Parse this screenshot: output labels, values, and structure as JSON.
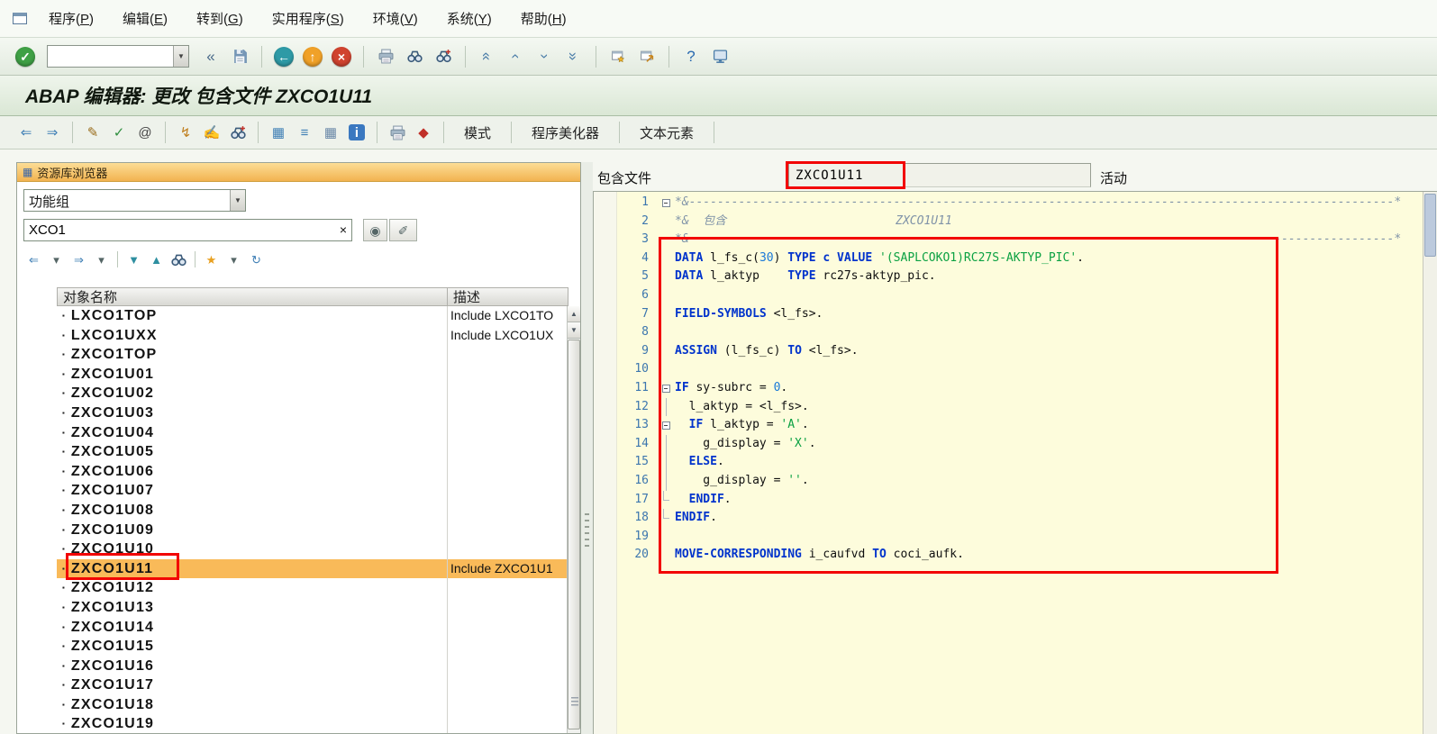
{
  "icons": {
    "dropdown_arrow": "▼",
    "clear": "×",
    "bullet": "▪",
    "scroll_up": "▲",
    "scroll_down": "▼",
    "repository": "▦",
    "search_help": "◉",
    "search_options": "✐"
  },
  "menu_bar": {
    "items": [
      {
        "label": "程序",
        "key": "P"
      },
      {
        "label": "编辑",
        "key": "E"
      },
      {
        "label": "转到",
        "key": "G"
      },
      {
        "label": "实用程序",
        "key": "S"
      },
      {
        "label": "环境",
        "key": "V"
      },
      {
        "label": "系统",
        "key": "Y"
      },
      {
        "label": "帮助",
        "key": "H"
      }
    ]
  },
  "std_toolbar": {
    "command_value": "",
    "items": [
      {
        "kind": "icon",
        "name": "enter-icon",
        "glyph": "✓",
        "fg": "#ffffff",
        "bg": "#3fa045",
        "circle": true
      },
      {
        "kind": "combo",
        "name": "command-field",
        "value": ""
      },
      {
        "kind": "icon",
        "name": "collapse-command-icon",
        "glyph": "«",
        "fg": "#4a6a8a"
      },
      {
        "kind": "svg",
        "svg": "floppy",
        "name": "save-icon"
      },
      {
        "kind": "sep"
      },
      {
        "kind": "icon",
        "name": "back-icon",
        "glyph": "←",
        "fg": "#ffffff",
        "bg": "#2e9aa6",
        "circle": true
      },
      {
        "kind": "icon",
        "name": "exit-icon",
        "glyph": "↑",
        "fg": "#ffffff",
        "bg": "#f0a128",
        "circle": true
      },
      {
        "kind": "icon",
        "name": "cancel-icon",
        "glyph": "×",
        "fg": "#ffffff",
        "bg": "#d0432f",
        "circle": true
      },
      {
        "kind": "sep"
      },
      {
        "kind": "svg",
        "svg": "printer",
        "name": "print-icon"
      },
      {
        "kind": "svg",
        "svg": "binoculars",
        "name": "find-icon"
      },
      {
        "kind": "svg",
        "svg": "binocplus",
        "name": "find-next-icon"
      },
      {
        "kind": "sep"
      },
      {
        "kind": "icon",
        "name": "first-page-icon",
        "glyph": "«",
        "fg": "#4a7ca8",
        "rot": true
      },
      {
        "kind": "icon",
        "name": "page-up-icon",
        "glyph": "‹",
        "fg": "#4a7ca8",
        "rot": true
      },
      {
        "kind": "icon",
        "name": "page-down-icon",
        "glyph": "›",
        "fg": "#4a7ca8",
        "rot": true
      },
      {
        "kind": "icon",
        "name": "last-page-icon",
        "glyph": "»",
        "fg": "#4a7ca8",
        "rot": true
      },
      {
        "kind": "sep"
      },
      {
        "kind": "svg",
        "svg": "winstar",
        "name": "new-session-icon"
      },
      {
        "kind": "svg",
        "svg": "winarrow",
        "name": "create-shortcut-icon"
      },
      {
        "kind": "sep"
      },
      {
        "kind": "icon",
        "name": "help-icon",
        "glyph": "?",
        "fg": "#2a6ab0"
      },
      {
        "kind": "svg",
        "svg": "monitor",
        "name": "layout-menu-icon"
      }
    ]
  },
  "title_bar": {
    "title": "ABAP 编辑器: 更改 包含文件 ZXCO1U11"
  },
  "app_toolbar": {
    "items": [
      {
        "kind": "icon",
        "name": "back-arrow-icon",
        "glyph": "⇐",
        "fg": "#3f7fb5"
      },
      {
        "kind": "icon",
        "name": "forward-arrow-icon",
        "glyph": "⇒",
        "fg": "#3f7fb5"
      },
      {
        "kind": "sep"
      },
      {
        "kind": "icon",
        "name": "display-change-icon",
        "glyph": "✎",
        "fg": "#996c1a"
      },
      {
        "kind": "icon",
        "name": "syntax-check-icon",
        "glyph": "✓",
        "fg": "#2f8f3f"
      },
      {
        "kind": "icon",
        "name": "activate-icon",
        "glyph": "@",
        "fg": "#444444"
      },
      {
        "kind": "sep"
      },
      {
        "kind": "icon",
        "name": "test-icon",
        "glyph": "↯",
        "fg": "#c08020"
      },
      {
        "kind": "icon",
        "name": "where-used-icon",
        "glyph": "✍",
        "fg": "#555555"
      },
      {
        "kind": "svg",
        "svg": "binocplus",
        "name": "find-next-icon"
      },
      {
        "kind": "sep"
      },
      {
        "kind": "icon",
        "name": "pattern-tree-icon",
        "glyph": "▦",
        "fg": "#3f7fb5"
      },
      {
        "kind": "icon",
        "name": "align-icon",
        "glyph": "≡",
        "fg": "#3f7fb5"
      },
      {
        "kind": "icon",
        "name": "table-display-icon",
        "glyph": "▦",
        "fg": "#6a88a8"
      },
      {
        "kind": "icon",
        "name": "info-icon",
        "glyph": "i",
        "fg": "#ffffff",
        "bg": "#3a78c0",
        "box": true
      },
      {
        "kind": "sep"
      },
      {
        "kind": "svg",
        "svg": "printer",
        "name": "print-preview-icon"
      },
      {
        "kind": "icon",
        "name": "runtime-analysis-icon",
        "glyph": "◆",
        "fg": "#c03028"
      },
      {
        "kind": "sep"
      }
    ],
    "buttons": [
      {
        "label": "模式",
        "name": "pattern-button"
      },
      {
        "label": "程序美化器",
        "name": "pretty-printer-button"
      },
      {
        "label": "文本元素",
        "name": "text-elements-button"
      }
    ]
  },
  "browser": {
    "header": "资源库浏览器",
    "category_value": "功能组",
    "search_value": "XCO1",
    "columns": [
      "对象名称",
      "描述"
    ],
    "toolbar": [
      {
        "kind": "icon",
        "name": "history-back-icon",
        "glyph": "⇐",
        "fg": "#3f7fb5"
      },
      {
        "kind": "icon",
        "name": "history-back-menu-icon",
        "glyph": "▾",
        "fg": "#566",
        "narrow": true
      },
      {
        "kind": "icon",
        "name": "history-forward-icon",
        "glyph": "⇒",
        "fg": "#3f7fb5"
      },
      {
        "kind": "icon",
        "name": "history-forward-menu-icon",
        "glyph": "▾",
        "fg": "#566",
        "narrow": true
      },
      {
        "kind": "sep"
      },
      {
        "kind": "icon",
        "name": "sort-descending-icon",
        "glyph": "▼",
        "fg": "#2e8fa0"
      },
      {
        "kind": "icon",
        "name": "sort-ascending-icon",
        "glyph": "▲",
        "fg": "#2e8fa0"
      },
      {
        "kind": "svg",
        "svg": "binoculars",
        "name": "find-icon"
      },
      {
        "kind": "sep"
      },
      {
        "kind": "icon",
        "name": "favorites-icon",
        "glyph": "★",
        "fg": "#e8a020"
      },
      {
        "kind": "icon",
        "name": "favorites-menu-icon",
        "glyph": "▾",
        "fg": "#566",
        "narrow": true
      },
      {
        "kind": "icon",
        "name": "refresh-icon",
        "glyph": "↻",
        "fg": "#3f7fb5"
      }
    ],
    "rows": [
      {
        "name": "LXCO1TOP",
        "desc": "Include LXCO1TO"
      },
      {
        "name": "LXCO1UXX",
        "desc": "Include LXCO1UX"
      },
      {
        "name": "ZXCO1TOP",
        "desc": ""
      },
      {
        "name": "ZXCO1U01",
        "desc": ""
      },
      {
        "name": "ZXCO1U02",
        "desc": ""
      },
      {
        "name": "ZXCO1U03",
        "desc": ""
      },
      {
        "name": "ZXCO1U04",
        "desc": ""
      },
      {
        "name": "ZXCO1U05",
        "desc": ""
      },
      {
        "name": "ZXCO1U06",
        "desc": ""
      },
      {
        "name": "ZXCO1U07",
        "desc": ""
      },
      {
        "name": "ZXCO1U08",
        "desc": ""
      },
      {
        "name": "ZXCO1U09",
        "desc": ""
      },
      {
        "name": "ZXCO1U10",
        "desc": ""
      },
      {
        "name": "ZXCO1U11",
        "desc": "Include ZXCO1U1",
        "selected": true
      },
      {
        "name": "ZXCO1U12",
        "desc": ""
      },
      {
        "name": "ZXCO1U13",
        "desc": ""
      },
      {
        "name": "ZXCO1U14",
        "desc": ""
      },
      {
        "name": "ZXCO1U15",
        "desc": ""
      },
      {
        "name": "ZXCO1U16",
        "desc": ""
      },
      {
        "name": "ZXCO1U17",
        "desc": ""
      },
      {
        "name": "ZXCO1U18",
        "desc": ""
      },
      {
        "name": "ZXCO1U19",
        "desc": ""
      }
    ]
  },
  "editor": {
    "include_label": "包含文件",
    "include_value": "ZXCO1U11",
    "status_label": "活动",
    "lines": [
      {
        "n": 1,
        "fold": "box",
        "tokens": [
          [
            "c",
            "*&----------------------------------------------------------------------------------------------------*"
          ]
        ]
      },
      {
        "n": 2,
        "tokens": [
          [
            "c",
            "*&  包含                        ZXCO1U11"
          ]
        ]
      },
      {
        "n": 3,
        "tokens": [
          [
            "c",
            "*&----------------------------------------------------------------------------------------------------*"
          ]
        ]
      },
      {
        "n": 4,
        "tokens": [
          [
            "k",
            "DATA"
          ],
          [
            "p",
            " l_fs_c("
          ],
          [
            "n",
            "30"
          ],
          [
            "p",
            ") "
          ],
          [
            "k",
            "TYPE"
          ],
          [
            "p",
            " "
          ],
          [
            "k",
            "c"
          ],
          [
            "p",
            " "
          ],
          [
            "k",
            "VALUE"
          ],
          [
            "p",
            " "
          ],
          [
            "s",
            "'(SAPLCOKO1)RC27S-AKTYP_PIC'"
          ],
          [
            "p",
            "."
          ]
        ]
      },
      {
        "n": 5,
        "tokens": [
          [
            "k",
            "DATA"
          ],
          [
            "p",
            " l_aktyp    "
          ],
          [
            "k",
            "TYPE"
          ],
          [
            "p",
            " rc27s-aktyp_pic."
          ]
        ]
      },
      {
        "n": 6,
        "tokens": []
      },
      {
        "n": 7,
        "tokens": [
          [
            "k",
            "FIELD-SYMBOLS"
          ],
          [
            "p",
            " <l_fs>."
          ]
        ]
      },
      {
        "n": 8,
        "tokens": []
      },
      {
        "n": 9,
        "tokens": [
          [
            "k",
            "ASSIGN"
          ],
          [
            "p",
            " (l_fs_c) "
          ],
          [
            "k",
            "TO"
          ],
          [
            "p",
            " <l_fs>."
          ]
        ]
      },
      {
        "n": 10,
        "tokens": []
      },
      {
        "n": 11,
        "fold": "box",
        "tokens": [
          [
            "k",
            "IF"
          ],
          [
            "p",
            " sy-subrc = "
          ],
          [
            "n",
            "0"
          ],
          [
            "p",
            "."
          ]
        ]
      },
      {
        "n": 12,
        "fold": "line",
        "tokens": [
          [
            "p",
            "  l_aktyp = <l_fs>."
          ]
        ]
      },
      {
        "n": 13,
        "fold": "box",
        "tokens": [
          [
            "p",
            "  "
          ],
          [
            "k",
            "IF"
          ],
          [
            "p",
            " l_aktyp = "
          ],
          [
            "s",
            "'A'"
          ],
          [
            "p",
            "."
          ]
        ]
      },
      {
        "n": 14,
        "fold": "line",
        "tokens": [
          [
            "p",
            "    g_display = "
          ],
          [
            "s",
            "'X'"
          ],
          [
            "p",
            "."
          ]
        ]
      },
      {
        "n": 15,
        "fold": "line",
        "tokens": [
          [
            "p",
            "  "
          ],
          [
            "k",
            "ELSE"
          ],
          [
            "p",
            "."
          ]
        ]
      },
      {
        "n": 16,
        "fold": "line",
        "tokens": [
          [
            "p",
            "    g_display = "
          ],
          [
            "s",
            "''"
          ],
          [
            "p",
            "."
          ]
        ]
      },
      {
        "n": 17,
        "fold": "end",
        "tokens": [
          [
            "p",
            "  "
          ],
          [
            "k",
            "ENDIF"
          ],
          [
            "p",
            "."
          ]
        ]
      },
      {
        "n": 18,
        "fold": "end",
        "tokens": [
          [
            "k",
            "ENDIF"
          ],
          [
            "p",
            "."
          ]
        ]
      },
      {
        "n": 19,
        "tokens": []
      },
      {
        "n": 20,
        "tokens": [
          [
            "k",
            "MOVE-CORRESPONDING"
          ],
          [
            "p",
            " i_caufvd "
          ],
          [
            "k",
            "TO"
          ],
          [
            "p",
            " coci_aufk."
          ]
        ]
      }
    ]
  }
}
